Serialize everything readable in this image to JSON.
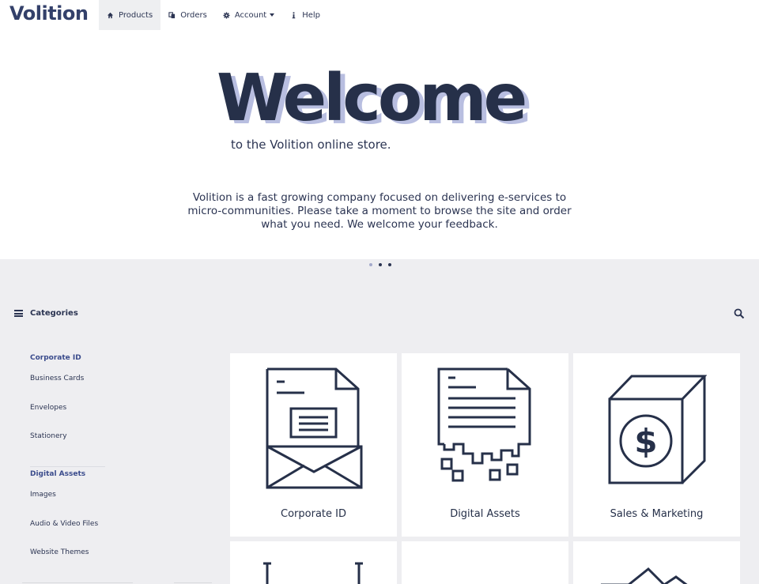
{
  "brand": "Volition",
  "nav": {
    "products": "Products",
    "orders": "Orders",
    "account": "Account",
    "help": "Help"
  },
  "hero": {
    "title": "Welcome",
    "tagline": "to the Volition online store.",
    "intro": "Volition is a fast growing company focused on delivering e-services to micro-communities. Please take a moment to browse the site and order what you need. We welcome your feedback."
  },
  "carousel": {
    "slides": 3,
    "active": 1
  },
  "categories": {
    "header": "Categories",
    "groups": [
      {
        "title": "Corporate ID",
        "items": [
          "Business Cards",
          "Envelopes",
          "Stationery"
        ]
      },
      {
        "title": "Digital Assets",
        "items": [
          "Images",
          "Audio & Video Files",
          "Website Themes"
        ]
      }
    ]
  },
  "cards": [
    {
      "label": "Corporate ID",
      "icon": "envelope-document-icon"
    },
    {
      "label": "Digital Assets",
      "icon": "digital-document-icon"
    },
    {
      "label": "Sales & Marketing",
      "icon": "money-box-icon"
    }
  ],
  "colors": {
    "accent": "#2b3452",
    "title_shadow": "#b8bee0",
    "link": "#3a4b8c",
    "content_bg": "#eeeef1"
  }
}
